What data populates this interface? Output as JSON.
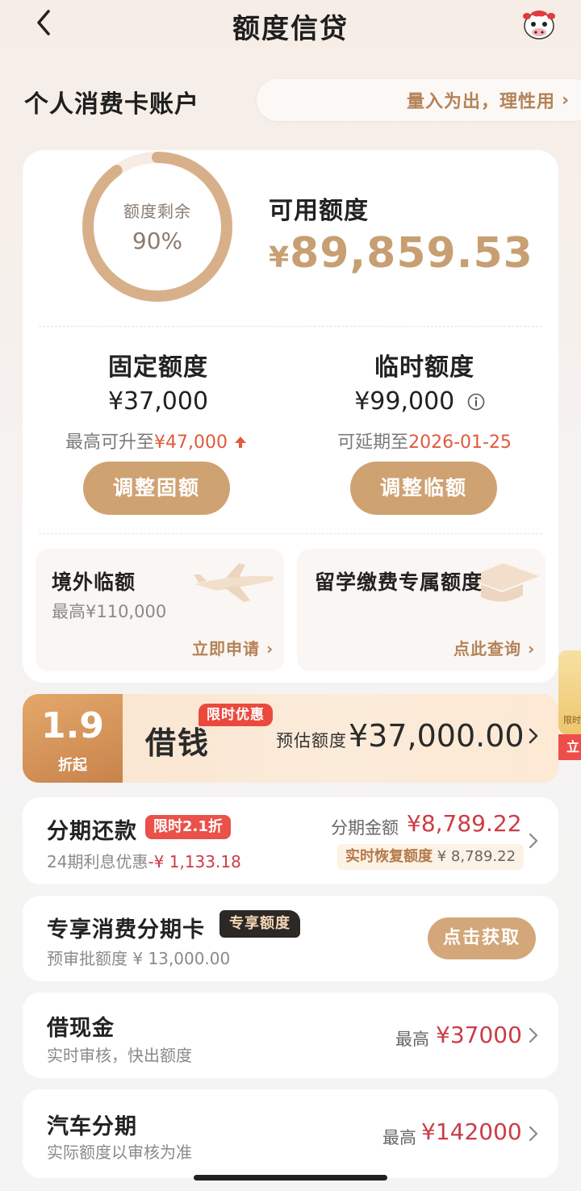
{
  "header": {
    "title": "额度信贷",
    "back_icon": "chevron-left-icon",
    "mascot_icon": "cow-mascot-icon"
  },
  "account": {
    "title": "个人消费卡账户",
    "slogan": "量入为出，理性用"
  },
  "overview": {
    "ring_label": "额度剩余",
    "ring_percent": "90%",
    "ring_fraction": 0.9,
    "available_label": "可用额度",
    "available_currency": "¥",
    "available_amount": "89,859.53"
  },
  "fixed": {
    "title": "固定额度",
    "amount": "¥37,000",
    "sub_prefix": "最高可升至",
    "sub_value": "¥47,000",
    "button": "调整固额"
  },
  "temporary": {
    "title": "临时额度",
    "amount": "¥99,000",
    "sub_prefix": "可延期至",
    "sub_value": "2026-01-25",
    "button": "调整临额"
  },
  "overseas": {
    "title": "境外临额",
    "sub": "最高¥110,000",
    "link": "立即申请"
  },
  "study": {
    "title": "留学缴费专属额度",
    "link": "点此查询"
  },
  "promo": {
    "rate": "1.9",
    "rate_sub": "折起",
    "tag": "限时优惠",
    "title": "借钱",
    "est_label": "预估额度",
    "amount": "¥37,000.00"
  },
  "side_float": {
    "text": "限时",
    "button": "立"
  },
  "installment": {
    "title": "分期还款",
    "tag": "限时2.1折",
    "sub_prefix": "24期利息优惠",
    "sub_value": "-¥ 1,133.18",
    "amount_label": "分期金额",
    "amount": "¥8,789.22",
    "recover_label": "实时恢复额度",
    "recover_amount": "¥ 8,789.22"
  },
  "exclusive": {
    "title": "专享消费分期卡",
    "tag": "专享额度",
    "sub": "预审批额度 ¥ 13,000.00",
    "button": "点击获取"
  },
  "cash": {
    "title": "借现金",
    "sub": "实时审核，快出额度",
    "right_label": "最高",
    "right_amount": "¥37000"
  },
  "car": {
    "title": "汽车分期",
    "sub": "实际额度以审核为准",
    "right_label": "最高",
    "right_amount": "¥142000"
  }
}
